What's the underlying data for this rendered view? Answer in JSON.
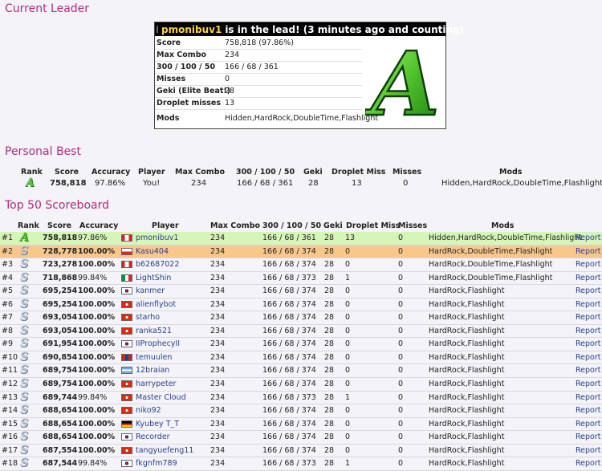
{
  "leader": {
    "title": "Current Leader",
    "name": "pmonibuv1",
    "status": "is in the lead! (3 minutes ago and counting)",
    "grade": "A",
    "fields": [
      {
        "label": "Score",
        "value": "758,818 (97.86%)"
      },
      {
        "label": "Max Combo",
        "value": "234"
      },
      {
        "label": "300 / 100 / 50",
        "value": "166 / 68 / 361"
      },
      {
        "label": "Misses",
        "value": "0"
      },
      {
        "label": "Geki (Elite Beat!)",
        "value": "28"
      },
      {
        "label": "Droplet misses",
        "value": "13"
      },
      {
        "label": "Mods",
        "value": "Hidden,HardRock,DoubleTime,Flashlight"
      }
    ]
  },
  "personal_best": {
    "title": "Personal Best",
    "headers": {
      "rank": "Rank",
      "score": "Score",
      "accuracy": "Accuracy",
      "player": "Player",
      "max_combo": "Max Combo",
      "hits": "300 / 100 / 50",
      "geki": "Geki",
      "droplet_miss": "Droplet Miss",
      "misses": "Misses",
      "mods": "Mods"
    },
    "row": {
      "grade": "A",
      "score": "758,818",
      "accuracy": "97.86%",
      "player": "You!",
      "max_combo": "234",
      "hits": "166 / 68 / 361",
      "geki": "28",
      "droplet_miss": "13",
      "misses": "0",
      "mods": "Hidden,HardRock,DoubleTime,Flashlight"
    }
  },
  "scoreboard": {
    "title": "Top 50 Scoreboard",
    "headers": {
      "rank": "Rank",
      "score": "Score",
      "accuracy": "Accuracy",
      "player": "Player",
      "max_combo": "Max Combo",
      "hits": "300 / 100 / 50",
      "geki": "Geki",
      "droplet_miss": "Droplet Miss",
      "misses": "Misses",
      "mods": "Mods"
    },
    "report_label": "Report",
    "rows": [
      {
        "pos": "#1",
        "grade": "A",
        "score": "758,818",
        "accuracy": "97.86%",
        "flag": "ca",
        "player": "pmonibuv1",
        "combo": "234",
        "hits": "166 / 68 / 361",
        "geki": "28",
        "droplet": "13",
        "misses": "0",
        "mods": "Hidden,HardRock,DoubleTime,Flashlight",
        "highlight": "leader"
      },
      {
        "pos": "#2",
        "grade": "S",
        "score": "728,778",
        "accuracy": "100.00%",
        "flag": "cl",
        "player": "Kasu404",
        "combo": "234",
        "hits": "166 / 68 / 374",
        "geki": "28",
        "droplet": "0",
        "misses": "0",
        "mods": "HardRock,DoubleTime,Flashlight",
        "highlight": "self"
      },
      {
        "pos": "#3",
        "grade": "S",
        "score": "723,278",
        "accuracy": "100.00%",
        "flag": "ca",
        "player": "b62687022",
        "combo": "234",
        "hits": "166 / 68 / 374",
        "geki": "28",
        "droplet": "0",
        "misses": "0",
        "mods": "HardRock,DoubleTime,Flashlight",
        "highlight": ""
      },
      {
        "pos": "#4",
        "grade": "S",
        "score": "718,868",
        "accuracy": "99.84%",
        "flag": "it",
        "player": "LightShin",
        "combo": "234",
        "hits": "166 / 68 / 373",
        "geki": "28",
        "droplet": "1",
        "misses": "0",
        "mods": "HardRock,DoubleTime,Flashlight",
        "highlight": ""
      },
      {
        "pos": "#5",
        "grade": "S",
        "score": "695,254",
        "accuracy": "100.00%",
        "flag": "kr",
        "player": "kanmer",
        "combo": "234",
        "hits": "166 / 68 / 374",
        "geki": "28",
        "droplet": "0",
        "misses": "0",
        "mods": "HardRock,Flashlight",
        "highlight": ""
      },
      {
        "pos": "#6",
        "grade": "S",
        "score": "695,254",
        "accuracy": "100.00%",
        "flag": "hk",
        "player": "alienflybot",
        "combo": "234",
        "hits": "166 / 68 / 374",
        "geki": "28",
        "droplet": "0",
        "misses": "0",
        "mods": "HardRock,Flashlight",
        "highlight": ""
      },
      {
        "pos": "#7",
        "grade": "S",
        "score": "693,054",
        "accuracy": "100.00%",
        "flag": "hk",
        "player": "starho",
        "combo": "234",
        "hits": "166 / 68 / 374",
        "geki": "28",
        "droplet": "0",
        "misses": "0",
        "mods": "HardRock,Flashlight",
        "highlight": ""
      },
      {
        "pos": "#8",
        "grade": "S",
        "score": "693,054",
        "accuracy": "100.00%",
        "flag": "hk",
        "player": "ranka521",
        "combo": "234",
        "hits": "166 / 68 / 374",
        "geki": "28",
        "droplet": "0",
        "misses": "0",
        "mods": "HardRock,Flashlight",
        "highlight": ""
      },
      {
        "pos": "#9",
        "grade": "S",
        "score": "691,954",
        "accuracy": "100.00%",
        "flag": "kr",
        "player": "IIProphecyII",
        "combo": "234",
        "hits": "166 / 68 / 374",
        "geki": "28",
        "droplet": "0",
        "misses": "0",
        "mods": "HardRock,Flashlight",
        "highlight": ""
      },
      {
        "pos": "#10",
        "grade": "S",
        "score": "690,854",
        "accuracy": "100.00%",
        "flag": "mn",
        "player": "temuulen",
        "combo": "234",
        "hits": "166 / 68 / 374",
        "geki": "28",
        "droplet": "0",
        "misses": "0",
        "mods": "HardRock,Flashlight",
        "highlight": ""
      },
      {
        "pos": "#11",
        "grade": "S",
        "score": "689,754",
        "accuracy": "100.00%",
        "flag": "ar",
        "player": "12braian",
        "combo": "234",
        "hits": "166 / 68 / 374",
        "geki": "28",
        "droplet": "0",
        "misses": "0",
        "mods": "HardRock,Flashlight",
        "highlight": ""
      },
      {
        "pos": "#12",
        "grade": "S",
        "score": "689,754",
        "accuracy": "100.00%",
        "flag": "hk",
        "player": "harrypeter",
        "combo": "234",
        "hits": "166 / 68 / 374",
        "geki": "28",
        "droplet": "0",
        "misses": "0",
        "mods": "HardRock,Flashlight",
        "highlight": ""
      },
      {
        "pos": "#13",
        "grade": "S",
        "score": "689,744",
        "accuracy": "99.84%",
        "flag": "hk",
        "player": "Master Cloud",
        "combo": "234",
        "hits": "166 / 68 / 373",
        "geki": "28",
        "droplet": "1",
        "misses": "0",
        "mods": "HardRock,Flashlight",
        "highlight": ""
      },
      {
        "pos": "#14",
        "grade": "S",
        "score": "688,654",
        "accuracy": "100.00%",
        "flag": "hk",
        "player": "niko92",
        "combo": "234",
        "hits": "166 / 68 / 374",
        "geki": "28",
        "droplet": "0",
        "misses": "0",
        "mods": "HardRock,Flashlight",
        "highlight": ""
      },
      {
        "pos": "#15",
        "grade": "S",
        "score": "688,654",
        "accuracy": "100.00%",
        "flag": "de",
        "player": "Kyubey T_T",
        "combo": "234",
        "hits": "166 / 68 / 374",
        "geki": "28",
        "droplet": "0",
        "misses": "0",
        "mods": "HardRock,Flashlight",
        "highlight": ""
      },
      {
        "pos": "#16",
        "grade": "S",
        "score": "688,654",
        "accuracy": "100.00%",
        "flag": "kr",
        "player": "Recorder",
        "combo": "234",
        "hits": "166 / 68 / 374",
        "geki": "28",
        "droplet": "0",
        "misses": "0",
        "mods": "HardRock,Flashlight",
        "highlight": ""
      },
      {
        "pos": "#17",
        "grade": "S",
        "score": "687,554",
        "accuracy": "100.00%",
        "flag": "hk",
        "player": "tangyuefeng11",
        "combo": "234",
        "hits": "166 / 68 / 374",
        "geki": "28",
        "droplet": "0",
        "misses": "0",
        "mods": "HardRock,Flashlight",
        "highlight": ""
      },
      {
        "pos": "#18",
        "grade": "S",
        "score": "687,544",
        "accuracy": "99.84%",
        "flag": "kr",
        "player": "fkgnfm789",
        "combo": "234",
        "hits": "166 / 68 / 373",
        "geki": "28",
        "droplet": "1",
        "misses": "0",
        "mods": "HardRock,Flashlight",
        "highlight": ""
      }
    ]
  },
  "colors": {
    "leader_row": "#d6f5b8",
    "self_row": "#fac78a",
    "grade_s": "#b7c2d3",
    "grade_a": "#4bbf2f"
  }
}
